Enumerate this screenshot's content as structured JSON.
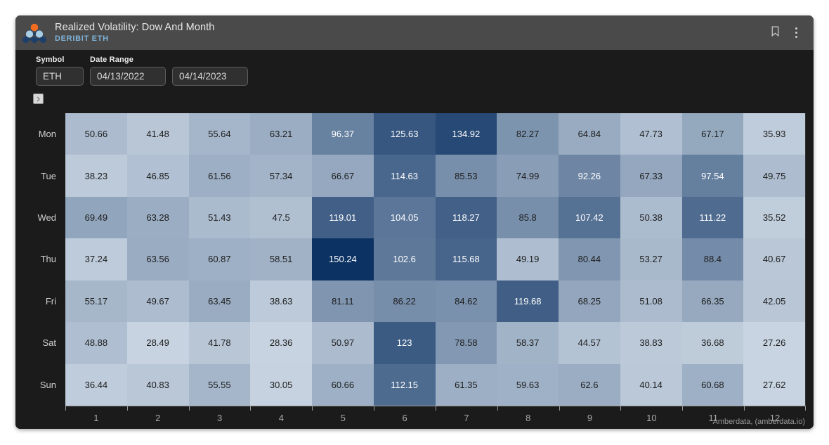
{
  "window": {
    "title": "Realized Volatility: Dow And Month",
    "subtitle": "DERIBIT ETH",
    "logo_icon": "amberdata-molecule-logo",
    "bookmark_icon": "bookmark-icon",
    "overflow_icon": "vertical-dots-icon"
  },
  "filters": {
    "symbol": {
      "label": "Symbol",
      "value": "ETH",
      "placeholder": "Symbol"
    },
    "date_range": {
      "label": "Date Range",
      "start_value": "04/13/2022",
      "end_value": "04/14/2023",
      "start_placeholder": "mm/dd/yyyy",
      "end_placeholder": "mm/dd/yyyy"
    },
    "expand_button_icon": "chevron-right-icon"
  },
  "footer": {
    "attribution": "Amberdata, (amberdata.io)"
  },
  "colors": {
    "window_background": "#1b1b1b",
    "title_bar": "#4a4a4a",
    "accent_subtitle": "#7fb2d8",
    "scale_low": "#c3d0de",
    "scale_high": "#0c3263",
    "text_light": "#e8e8e8",
    "text_muted": "#a9a9a9"
  },
  "chart_data": {
    "type": "heatmap",
    "title": "Realized Volatility: Dow And Month",
    "subtitle": "DERIBIT ETH",
    "xlabel": "",
    "ylabel": "",
    "x": [
      "1",
      "2",
      "3",
      "4",
      "5",
      "6",
      "7",
      "8",
      "9",
      "10",
      "11",
      "12"
    ],
    "y": [
      "Mon",
      "Tue",
      "Wed",
      "Thu",
      "Fri",
      "Sat",
      "Sun"
    ],
    "zmin": 27.26,
    "zmax": 150.24,
    "colorscale": [
      "#c8d4e1",
      "#0c3263"
    ],
    "grid": false,
    "legend": "none",
    "values": [
      [
        50.66,
        41.48,
        55.64,
        63.21,
        96.37,
        125.63,
        134.92,
        82.27,
        64.84,
        47.73,
        67.17,
        35.93
      ],
      [
        38.23,
        46.85,
        61.56,
        57.34,
        66.67,
        114.63,
        85.53,
        74.99,
        92.26,
        67.33,
        97.54,
        49.75
      ],
      [
        69.49,
        63.28,
        51.43,
        47.5,
        119.01,
        104.05,
        118.27,
        85.8,
        107.42,
        50.38,
        111.22,
        35.52
      ],
      [
        37.24,
        63.56,
        60.87,
        58.51,
        150.24,
        102.6,
        115.68,
        49.19,
        80.44,
        53.27,
        88.4,
        40.67
      ],
      [
        55.17,
        49.67,
        63.45,
        38.63,
        81.11,
        86.22,
        84.62,
        119.68,
        68.25,
        51.08,
        66.35,
        42.05
      ],
      [
        48.88,
        28.49,
        41.78,
        28.36,
        50.97,
        123,
        78.58,
        58.37,
        44.57,
        38.83,
        36.68,
        27.26
      ],
      [
        36.44,
        40.83,
        55.55,
        30.05,
        60.66,
        112.15,
        61.35,
        59.63,
        62.6,
        40.14,
        60.68,
        27.62
      ]
    ]
  }
}
